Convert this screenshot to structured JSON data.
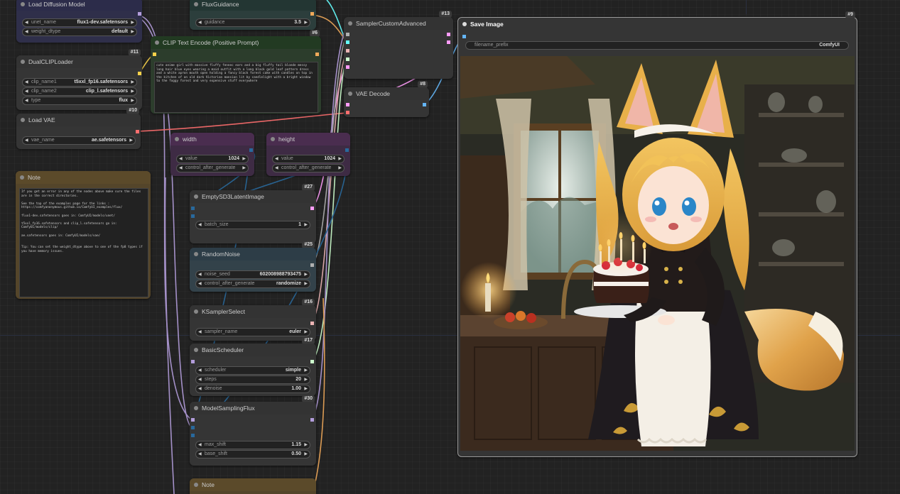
{
  "colors": {
    "clip": "#f7d14a",
    "model": "#b39ddb",
    "conditioning": "#f0a95a",
    "vae": "#ff6e6e",
    "latent": "#ff9cf9",
    "image": "#64b5f6",
    "noise": "#b0b0b0",
    "sampler": "#ecb4b4",
    "sigmas": "#cdffcd",
    "guider": "#66ffff",
    "int": "#29699c"
  },
  "nodes": {
    "load_diffusion_model": {
      "title": "Load Diffusion Model",
      "widgets": [
        {
          "label": "unet_name",
          "value": "flux1-dev.safetensors"
        },
        {
          "label": "weight_dtype",
          "value": "default"
        }
      ]
    },
    "dual_clip_loader": {
      "title": "DualCLIPLoader",
      "badge": "#11",
      "widgets": [
        {
          "label": "clip_name1",
          "value": "t5xxl_fp16.safetensors"
        },
        {
          "label": "clip_name2",
          "value": "clip_l.safetensors"
        },
        {
          "label": "type",
          "value": "flux"
        }
      ]
    },
    "load_vae": {
      "title": "Load VAE",
      "badge": "#10",
      "widgets": [
        {
          "label": "vae_name",
          "value": "ae.safetensors"
        }
      ]
    },
    "note_left": {
      "title": "Note",
      "text": "If you get an error in any of the nodes above make sure the files are in the correct directories.\n\nSee the top of the examples page for the links : https://comfyanonymous.github.io/ComfyUI_examples/flux/\n\nflux1-dev.safetensors goes in: ComfyUI/models/unet/\n\nt5xxl_fp16.safetensors and clip_l.safetensors go in: ComfyUI/models/clip/\n\nae.safetensors goes in: ComfyUI/models/vae/\n\n\nTip: You can set the weight_dtype above to one of the fp8 types if you have memory issues."
    },
    "flux_guidance": {
      "title": "FluxGuidance",
      "widgets": [
        {
          "label": "guidance",
          "value": "3.5"
        }
      ]
    },
    "clip_text_encode": {
      "title": "CLIP Text Encode (Positive Prompt)",
      "badge": "#6",
      "text": "cute anime girl with massive fluffy fennec ears and a big fluffy tail blonde messy long hair blue eyes wearing a maid outfit with a long black gold leaf pattern dress and a white apron mouth open holding a fancy black forest cake with candles on top in the kitchen of an old dark Victorian mansion lit by candlelight with a bright window to the foggy forest and very expensive stuff everywhere"
    },
    "width": {
      "title": "width",
      "widgets": [
        {
          "label": "value",
          "value": "1024"
        },
        {
          "label": "control_after_generate",
          "value": "fixed"
        }
      ]
    },
    "height": {
      "title": "height",
      "widgets": [
        {
          "label": "value",
          "value": "1024"
        },
        {
          "label": "control_after_generate",
          "value": "fixed"
        }
      ]
    },
    "empty_latent": {
      "title": "EmptySD3LatentImage",
      "badge": "#27",
      "widgets": [
        {
          "label": "batch_size",
          "value": "1"
        }
      ]
    },
    "random_noise": {
      "title": "RandomNoise",
      "badge": "#25",
      "widgets": [
        {
          "label": "noise_seed",
          "value": "602008988793475"
        },
        {
          "label": "control_after_generate",
          "value": "randomize"
        }
      ]
    },
    "ksampler_select": {
      "title": "KSamplerSelect",
      "badge": "#16",
      "widgets": [
        {
          "label": "sampler_name",
          "value": "euler"
        }
      ]
    },
    "basic_scheduler": {
      "title": "BasicScheduler",
      "badge": "#17",
      "widgets": [
        {
          "label": "scheduler",
          "value": "simple"
        },
        {
          "label": "steps",
          "value": "20"
        },
        {
          "label": "denoise",
          "value": "1.00"
        }
      ]
    },
    "model_sampling_flux": {
      "title": "ModelSamplingFlux",
      "badge": "#30",
      "widgets": [
        {
          "label": "max_shift",
          "value": "1.15"
        },
        {
          "label": "base_shift",
          "value": "0.50"
        }
      ]
    },
    "note_bottom": {
      "title": "Note"
    },
    "sampler_custom_advanced": {
      "title": "SamplerCustomAdvanced",
      "badge": "#13"
    },
    "vae_decode": {
      "title": "VAE Decode",
      "badge": "#8"
    },
    "save_image": {
      "title": "Save Image",
      "badge": "#9",
      "widgets": [
        {
          "label": "filename_prefix",
          "value": "ComfyUI"
        }
      ]
    }
  }
}
